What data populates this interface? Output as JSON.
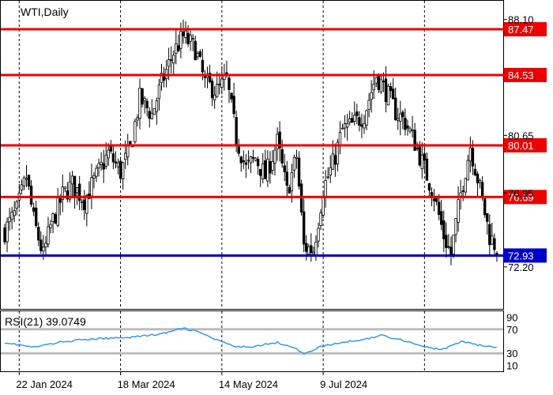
{
  "chart_data": [
    {
      "type": "candlestick",
      "title": "WTI,Daily",
      "x_tick_labels": [
        "22 Jan 2024",
        "18 Mar 2024",
        "14 May 2024",
        "9 Jul 2024"
      ],
      "y_ticks": [
        "88.10",
        "80.65",
        "76.95",
        "72.20"
      ],
      "ylim": [
        69.5,
        89.3
      ],
      "levels": [
        {
          "value": 87.47,
          "label": "87.47",
          "color": "#ee0000"
        },
        {
          "value": 84.53,
          "label": "84.53",
          "color": "#ee0000"
        },
        {
          "value": 80.01,
          "label": "80.01",
          "color": "#ee0000"
        },
        {
          "value": 76.69,
          "label": "76.69",
          "color": "#ee0000"
        },
        {
          "value": 72.93,
          "label": "72.93",
          "color": "#0000cc"
        }
      ],
      "close_anchors": [
        [
          0,
          74.5
        ],
        [
          5,
          75.8
        ],
        [
          9,
          78.0
        ],
        [
          12,
          75.2
        ],
        [
          16,
          72.9
        ],
        [
          19,
          74.8
        ],
        [
          24,
          76.8
        ],
        [
          28,
          77.5
        ],
        [
          33,
          76.5
        ],
        [
          38,
          78.0
        ],
        [
          43,
          79.5
        ],
        [
          48,
          78.3
        ],
        [
          52,
          79.8
        ],
        [
          56,
          83.0
        ],
        [
          61,
          82.0
        ],
        [
          65,
          84.0
        ],
        [
          70,
          86.0
        ],
        [
          74,
          87.0
        ],
        [
          79,
          86.2
        ],
        [
          83,
          84.0
        ],
        [
          88,
          83.5
        ],
        [
          92,
          84.2
        ],
        [
          96,
          80.5
        ],
        [
          100,
          78.5
        ],
        [
          104,
          79.2
        ],
        [
          108,
          78.0
        ],
        [
          113,
          80.2
        ],
        [
          117,
          77.0
        ],
        [
          121,
          79.3
        ],
        [
          124,
          73.5
        ],
        [
          128,
          73.3
        ],
        [
          132,
          77.2
        ],
        [
          136,
          78.8
        ],
        [
          140,
          81.0
        ],
        [
          144,
          81.3
        ],
        [
          149,
          82.0
        ],
        [
          154,
          84.5
        ],
        [
          158,
          83.5
        ],
        [
          162,
          82.2
        ],
        [
          166,
          81.5
        ],
        [
          170,
          80.2
        ],
        [
          174,
          78.5
        ],
        [
          178,
          76.8
        ],
        [
          182,
          74.2
        ],
        [
          185,
          73.0
        ],
        [
          189,
          76.9
        ],
        [
          193,
          80.0
        ],
        [
          197,
          77.2
        ],
        [
          201,
          74.2
        ],
        [
          204,
          73.4
        ]
      ]
    },
    {
      "type": "line",
      "title": "RSI(21) 39.0749",
      "y_ticks": [
        "90",
        "70",
        "30",
        "10"
      ],
      "ylim": [
        0,
        100
      ],
      "guide_levels": [
        70,
        30
      ],
      "line_color": "#3399ee",
      "anchors": [
        [
          0,
          48
        ],
        [
          12,
          40
        ],
        [
          25,
          50
        ],
        [
          38,
          54
        ],
        [
          52,
          57
        ],
        [
          65,
          62
        ],
        [
          74,
          72
        ],
        [
          80,
          66
        ],
        [
          88,
          52
        ],
        [
          96,
          40
        ],
        [
          104,
          42
        ],
        [
          113,
          48
        ],
        [
          120,
          40
        ],
        [
          124,
          28
        ],
        [
          130,
          40
        ],
        [
          140,
          48
        ],
        [
          150,
          54
        ],
        [
          156,
          60
        ],
        [
          165,
          52
        ],
        [
          175,
          40
        ],
        [
          181,
          36
        ],
        [
          190,
          50
        ],
        [
          196,
          44
        ],
        [
          204,
          39
        ]
      ]
    }
  ]
}
